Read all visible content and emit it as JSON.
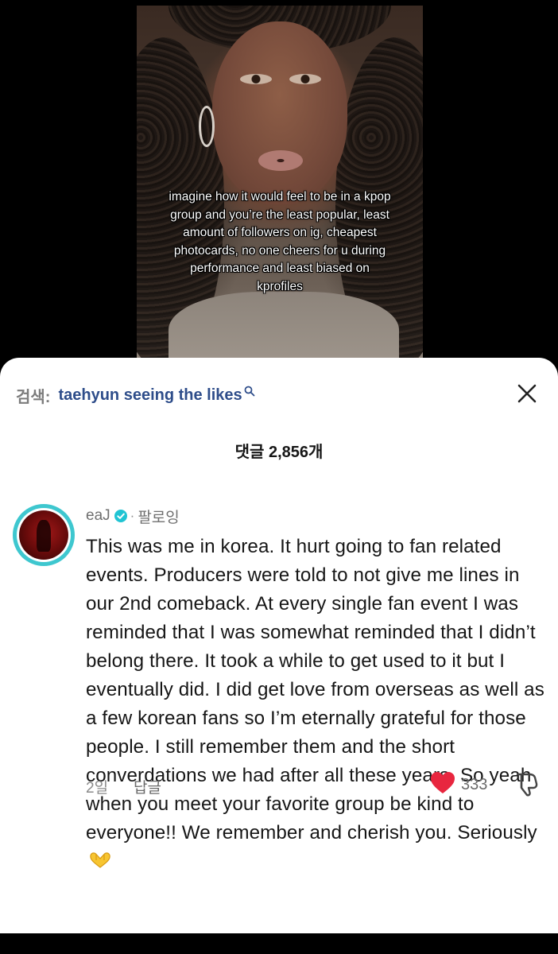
{
  "video": {
    "caption": "imagine how it would feel to be in a kpop group and you’re the least popular, least amount of followers on ig, cheapest photocards, no one cheers for u during performance and least biased on kprofiles"
  },
  "search": {
    "prefix": "검색:",
    "query": "taehyun seeing the likes",
    "icon": "search-icon",
    "link_color": "#2e4d8a"
  },
  "header": {
    "comment_count": "댓글 2,856개",
    "close_icon": "close-icon"
  },
  "comment": {
    "author": "eaJ",
    "verified": true,
    "separator": "·",
    "follow_status": "팔로잉",
    "text": "This was me in korea. It hurt going to fan related events. Producers were told to not give me lines in our 2nd comeback. At every single fan event I was reminded that I was somewhat reminded that I didn’t belong there. It took a while to get used to it but I eventually did. I did get love from overseas as well as a few korean fans so I’m eternally grateful for those people. I still remember them and the short converdations we had after all these years. So yeah when you meet your favorite group be kind to everyone!! We remember and cherish you. Seriously",
    "emoji_icon": "heart-hands-icon",
    "time_ago": "2일",
    "reply_label": "답글",
    "like_count": "333",
    "liked": true,
    "avatar_ring_color": "#3ec7cf",
    "like_color": "#e8263f"
  }
}
